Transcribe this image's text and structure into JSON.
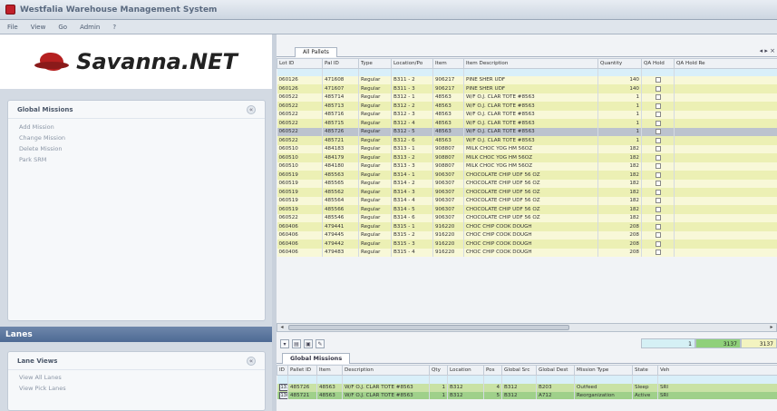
{
  "window": {
    "title": "Westfalia Warehouse Management System"
  },
  "menu": [
    "File",
    "View",
    "Go",
    "Admin",
    "?"
  ],
  "logo": {
    "text": "Savanna.NET"
  },
  "global_missions": {
    "title": "Global Missions",
    "items": [
      "Add Mission",
      "Change Mission",
      "Delete Mission",
      "Park SRM"
    ]
  },
  "lanes": {
    "header": "Lanes",
    "group_title": "Lane Views",
    "items": [
      "View All Lanes",
      "View Pick Lanes"
    ]
  },
  "pallets": {
    "tab": "All Pallets",
    "nav": "◂ ▸ ×",
    "columns": [
      "Lot ID",
      "Pal ID",
      "Type",
      "Location/Po",
      "Item",
      "Item Description",
      "Quantity",
      "QA Hold",
      "QA Hold Re"
    ],
    "rows": [
      [
        "060126",
        "471608",
        "Regular",
        "B311 - 2",
        "906217",
        "PINE SHER      UDF",
        "140",
        false
      ],
      [
        "060126",
        "471607",
        "Regular",
        "B311 - 3",
        "906217",
        "PINE SHER      UDF",
        "140",
        false
      ],
      [
        "060522",
        "485714",
        "Regular",
        "B312 - 1",
        "48563",
        "W/F O.J. CLAR TOTE #8563",
        "1",
        false
      ],
      [
        "060522",
        "485713",
        "Regular",
        "B312 - 2",
        "48563",
        "W/F O.J. CLAR TOTE #8563",
        "1",
        false
      ],
      [
        "060522",
        "485716",
        "Regular",
        "B312 - 3",
        "48563",
        "W/F O.J. CLAR TOTE #8563",
        "1",
        false
      ],
      [
        "060522",
        "485715",
        "Regular",
        "B312 - 4",
        "48563",
        "W/F O.J. CLAR TOTE #8563",
        "1",
        false
      ],
      [
        "060522",
        "485726",
        "Regular",
        "B312 - 5",
        "48563",
        "W/F O.J. CLAR TOTE #8563",
        "1",
        false
      ],
      [
        "060522",
        "485721",
        "Regular",
        "B312 - 6",
        "48563",
        "W/F O.J. CLAR TOTE #8563",
        "1",
        false
      ],
      [
        "060510",
        "484183",
        "Regular",
        "B313 - 1",
        "908807",
        "MILK CHOC YOG HM 56OZ",
        "182",
        false
      ],
      [
        "060510",
        "484179",
        "Regular",
        "B313 - 2",
        "908807",
        "MILK CHOC YOG HM 56OZ",
        "182",
        false
      ],
      [
        "060510",
        "484180",
        "Regular",
        "B313 - 3",
        "908807",
        "MILK CHOC YOG HM 56OZ",
        "182",
        false
      ],
      [
        "060519",
        "485563",
        "Regular",
        "B314 - 1",
        "906307",
        "CHOCOLATE CHIP UDF 56 OZ",
        "182",
        false
      ],
      [
        "060519",
        "485565",
        "Regular",
        "B314 - 2",
        "906307",
        "CHOCOLATE CHIP UDF 56 OZ",
        "182",
        false
      ],
      [
        "060519",
        "485562",
        "Regular",
        "B314 - 3",
        "906307",
        "CHOCOLATE CHIP UDF 56 OZ",
        "182",
        false
      ],
      [
        "060519",
        "485564",
        "Regular",
        "B314 - 4",
        "906307",
        "CHOCOLATE CHIP UDF 56 OZ",
        "182",
        false
      ],
      [
        "060519",
        "485566",
        "Regular",
        "B314 - 5",
        "906307",
        "CHOCOLATE CHIP UDF 56 OZ",
        "182",
        false
      ],
      [
        "060522",
        "485546",
        "Regular",
        "B314 - 6",
        "906307",
        "CHOCOLATE CHIP UDF 56 OZ",
        "182",
        false
      ],
      [
        "060406",
        "479441",
        "Regular",
        "B315 - 1",
        "916220",
        "CHOC CHIP COOK DOUGH",
        "208",
        false
      ],
      [
        "060406",
        "479445",
        "Regular",
        "B315 - 2",
        "916220",
        "CHOC CHIP COOK DOUGH",
        "208",
        false
      ],
      [
        "060406",
        "479442",
        "Regular",
        "B315 - 3",
        "916220",
        "CHOC CHIP COOK DOUGH",
        "208",
        false
      ],
      [
        "060406",
        "479483",
        "Regular",
        "B315 - 4",
        "916220",
        "CHOC CHIP COOK DOUGH",
        "208",
        false
      ]
    ],
    "selected_row": 6
  },
  "counts": [
    "1",
    "3137",
    "3137"
  ],
  "missions_grid": {
    "tab": "Global Missions",
    "columns": [
      "ID",
      "Pallet ID",
      "Item",
      "Description",
      "Qty",
      "Location",
      "Pos",
      "Global Src",
      "Global Dest",
      "Mission Type",
      "State",
      "Veh"
    ],
    "rows": [
      [
        "131",
        "485726",
        "48563",
        "W/F O.J. CLAR TOTE #8563",
        "1",
        "B312",
        "4",
        "B312",
        "B203",
        "Outfeed",
        "Sleep",
        "SRI"
      ],
      [
        "130",
        "485721",
        "48563",
        "W/F O.J. CLAR TOTE #8563",
        "1",
        "B312",
        "5",
        "B312",
        "A712",
        "Reorganization",
        "Active",
        "SRI"
      ]
    ]
  }
}
